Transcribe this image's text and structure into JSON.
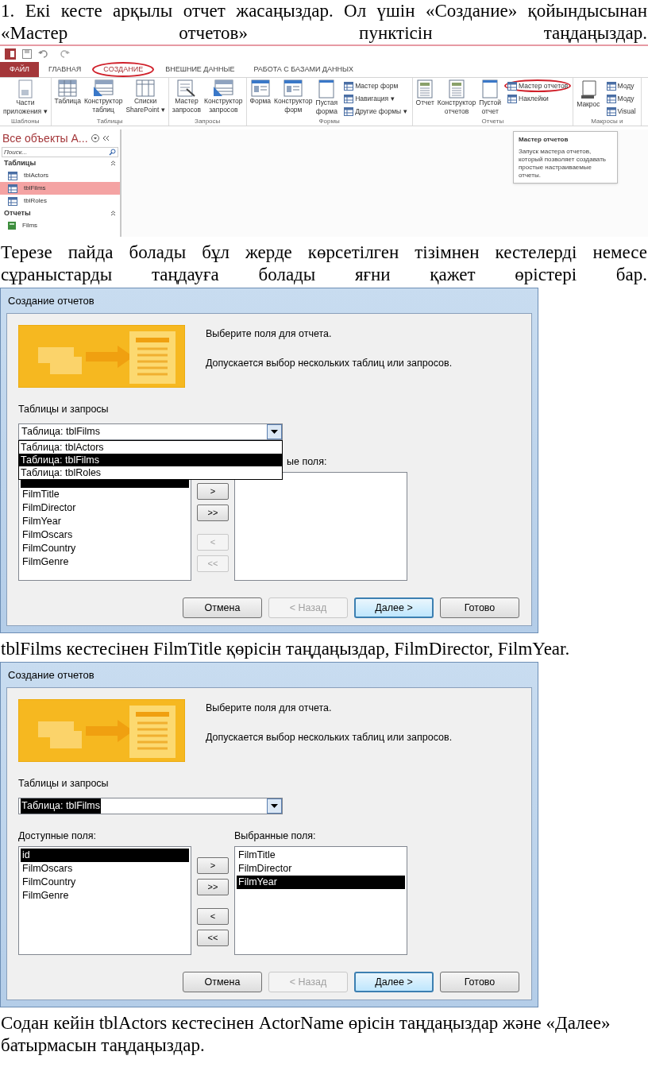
{
  "instruction_1": "1. Екі кесте арқылы отчет жасаңыздар. Ол үшін «Создание» қойындысынан «Мастер отчетов» пунктісін таңдаңыздар.",
  "access_screenshot": {
    "tabs": [
      {
        "label": "ФАЙЛ",
        "kind": "file",
        "selected": false,
        "circled": false
      },
      {
        "label": "ГЛАВНАЯ",
        "kind": "tab",
        "selected": false,
        "circled": false
      },
      {
        "label": "СОЗДАНИЕ",
        "kind": "tab",
        "selected": true,
        "circled": true
      },
      {
        "label": "ВНЕШНИЕ ДАННЫЕ",
        "kind": "tab",
        "selected": false,
        "circled": false
      },
      {
        "label": "РАБОТА С БАЗАМИ ДАННЫХ",
        "kind": "tab",
        "selected": false,
        "circled": false
      }
    ],
    "groups": [
      {
        "label": "Шаблоны",
        "large": [
          {
            "lines": [
              "Части",
              "приложения ▾"
            ]
          }
        ]
      },
      {
        "label": "Таблицы",
        "large": [
          {
            "lines": [
              "Таблица"
            ]
          },
          {
            "lines": [
              "Конструктор",
              "таблиц"
            ]
          },
          {
            "lines": [
              "Списки",
              "SharePoint ▾"
            ]
          }
        ]
      },
      {
        "label": "Запросы",
        "large": [
          {
            "lines": [
              "Мастер",
              "запросов"
            ]
          },
          {
            "lines": [
              "Конструктор",
              "запросов"
            ]
          }
        ]
      },
      {
        "label": "Формы",
        "large": [
          {
            "lines": [
              "Форма"
            ]
          },
          {
            "lines": [
              "Конструктор",
              "форм"
            ]
          },
          {
            "lines": [
              "Пустая",
              "форма"
            ]
          }
        ],
        "small": [
          {
            "label": "Мастер форм",
            "circled": false
          },
          {
            "label": "Навигация ▾",
            "circled": false
          },
          {
            "label": "Другие формы ▾",
            "circled": false
          }
        ]
      },
      {
        "label": "Отчеты",
        "large": [
          {
            "lines": [
              "Отчет"
            ]
          },
          {
            "lines": [
              "Конструктор",
              "отчетов"
            ]
          },
          {
            "lines": [
              "Пустой",
              "отчет"
            ]
          }
        ],
        "small": [
          {
            "label": "Мастер отчетов",
            "circled": true
          },
          {
            "label": "Наклейки",
            "circled": false
          }
        ]
      },
      {
        "label": "Макросы и",
        "large": [
          {
            "lines": [
              "Макрос"
            ]
          }
        ],
        "small": [
          {
            "label": "Моду",
            "circled": false
          },
          {
            "label": "Моду",
            "circled": false
          },
          {
            "label": "Visual",
            "circled": false
          }
        ]
      }
    ],
    "nav": {
      "title": "Все объекты А...",
      "search_placeholder": "Поиск...",
      "sections": [
        {
          "label": "Таблицы",
          "items": [
            {
              "label": "tblActors",
              "selected": false
            },
            {
              "label": "tblFilms",
              "selected": true
            },
            {
              "label": "tblRoles",
              "selected": false
            }
          ]
        },
        {
          "label": "Отчеты",
          "items": [
            {
              "label": "Films",
              "selected": false
            }
          ]
        }
      ]
    },
    "tooltip": {
      "title": "Мастер отчетов",
      "text": "Запуск мастера отчетов, который позволяет создавать простые настраиваемые отчеты."
    }
  },
  "instruction_2": "Терезе пайда болады бұл жерде көрсетілген тізімнен кестелерді немесе сұраныстарды таңдауға болады яғни қажет өрістері бар.",
  "wizard_1": {
    "title": "Создание отчетов",
    "heading": "Выберите поля для отчета.",
    "note": "Допускается выбор нескольких таблиц или запросов.",
    "source_label": "Таблицы и запросы",
    "source_value": "Таблица: tblFilms",
    "source_value_highlighted": false,
    "dropdown": [
      {
        "label": "Таблица: tblActors",
        "selected": false
      },
      {
        "label": "Таблица: tblFilms",
        "selected": true
      },
      {
        "label": "Таблица: tblRoles",
        "selected": false
      }
    ],
    "selected_label": "ые поля:",
    "available_fields": [
      {
        "label": "FilmTitle",
        "selected": false
      },
      {
        "label": "FilmDirector",
        "selected": false
      },
      {
        "label": "FilmYear",
        "selected": false
      },
      {
        "label": "FilmOscars",
        "selected": false
      },
      {
        "label": "FilmCountry",
        "selected": false
      },
      {
        "label": "FilmGenre",
        "selected": false
      }
    ],
    "move_buttons": [
      {
        "label": ">",
        "disabled": false
      },
      {
        "label": ">>",
        "disabled": false
      },
      {
        "label": "<",
        "disabled": true
      },
      {
        "label": "<<",
        "disabled": true
      }
    ],
    "buttons": [
      {
        "label": "Отмена",
        "disabled": false,
        "default": false
      },
      {
        "label": "< Назад",
        "disabled": true,
        "default": false
      },
      {
        "label": "Далее >",
        "disabled": false,
        "default": true
      },
      {
        "label": "Готово",
        "disabled": false,
        "default": false
      }
    ]
  },
  "instruction_3": "tblFilms кестесінен  FilmTitle қөрісін таңдаңыздар, FilmDirector, FilmYear.",
  "wizard_2": {
    "title": "Создание отчетов",
    "heading": "Выберите поля для отчета.",
    "note": "Допускается выбор нескольких таблиц или запросов.",
    "source_label": "Таблицы и запросы",
    "source_value": "Таблица: tblFilms",
    "source_value_highlighted": true,
    "available_label": "Доступные поля:",
    "selected_label": "Выбранные поля:",
    "available_fields": [
      {
        "label": "id",
        "selected": true
      },
      {
        "label": "FilmOscars",
        "selected": false
      },
      {
        "label": "FilmCountry",
        "selected": false
      },
      {
        "label": "FilmGenre",
        "selected": false
      }
    ],
    "selected_fields": [
      {
        "label": "FilmTitle",
        "selected": false
      },
      {
        "label": "FilmDirector",
        "selected": false
      },
      {
        "label": "FilmYear",
        "selected": true
      }
    ],
    "move_buttons": [
      {
        "label": ">",
        "disabled": false
      },
      {
        "label": ">>",
        "disabled": false
      },
      {
        "label": "<",
        "disabled": false
      },
      {
        "label": "<<",
        "disabled": false
      }
    ],
    "buttons": [
      {
        "label": "Отмена",
        "disabled": false,
        "default": false
      },
      {
        "label": "< Назад",
        "disabled": true,
        "default": false
      },
      {
        "label": "Далее >",
        "disabled": false,
        "default": true
      },
      {
        "label": "Готово",
        "disabled": false,
        "default": false
      }
    ]
  },
  "instruction_4": "Содан кейін tblActors кестесінен  ActorName өрісін таңдаңыздар және «Далее» батырмасын таңдаңыздар."
}
